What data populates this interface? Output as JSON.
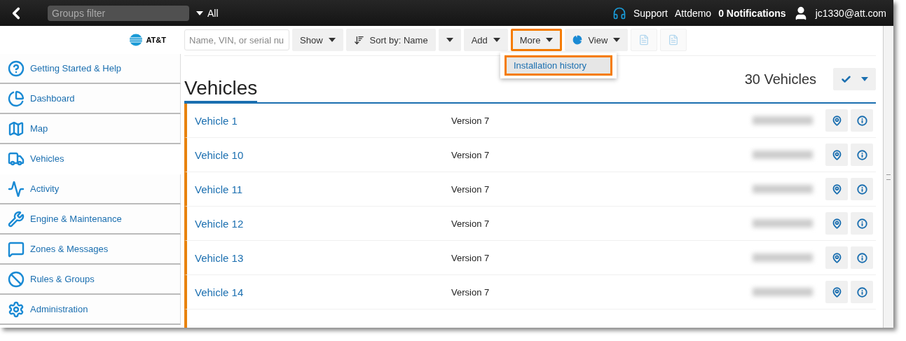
{
  "top_bar": {
    "groups_filter": {
      "placeholder": "Groups filter"
    },
    "groups_selector": "All",
    "support": "Support",
    "account": "Attdemo",
    "notifications": "0 Notifications",
    "user": "jc1330@att.com"
  },
  "sidebar": {
    "logo": "AT&T",
    "items": [
      {
        "label": "Getting Started & Help",
        "selected": false
      },
      {
        "label": "Dashboard",
        "selected": false
      },
      {
        "label": "Map",
        "selected": false
      },
      {
        "label": "Vehicles",
        "selected": true
      },
      {
        "label": "Activity",
        "selected": false
      },
      {
        "label": "Engine & Maintenance",
        "selected": false
      },
      {
        "label": "Zones & Messages",
        "selected": false
      },
      {
        "label": "Rules & Groups",
        "selected": false
      },
      {
        "label": "Administration",
        "selected": false
      }
    ]
  },
  "toolbar": {
    "search": {
      "placeholder": "Name, VIN, or serial nu"
    },
    "buttons": [
      {
        "kind": "dropdown",
        "label": "Show",
        "highlighted": false
      },
      {
        "kind": "sort",
        "label": "Sort by: Name",
        "highlighted": false
      },
      {
        "kind": "dropdown",
        "label": "Add",
        "highlighted": false
      },
      {
        "kind": "dropdown",
        "label": "More",
        "highlighted": true
      },
      {
        "kind": "view",
        "label": "View",
        "highlighted": false
      },
      {
        "kind": "doc",
        "disabled": true
      },
      {
        "kind": "doc",
        "disabled": true
      }
    ]
  },
  "more_menu": {
    "items": [
      {
        "label": "Installation history",
        "highlighted": true
      }
    ]
  },
  "page": {
    "title": "Vehicles",
    "count": "30 Vehicles"
  },
  "vehicles": [
    {
      "name": "Vehicle 1",
      "version": "Version 7"
    },
    {
      "name": "Vehicle 10",
      "version": "Version 7"
    },
    {
      "name": "Vehicle 11",
      "version": "Version 7"
    },
    {
      "name": "Vehicle 12",
      "version": "Version 7"
    },
    {
      "name": "Vehicle 13",
      "version": "Version 7"
    },
    {
      "name": "Vehicle 14",
      "version": "Version 7"
    }
  ]
}
